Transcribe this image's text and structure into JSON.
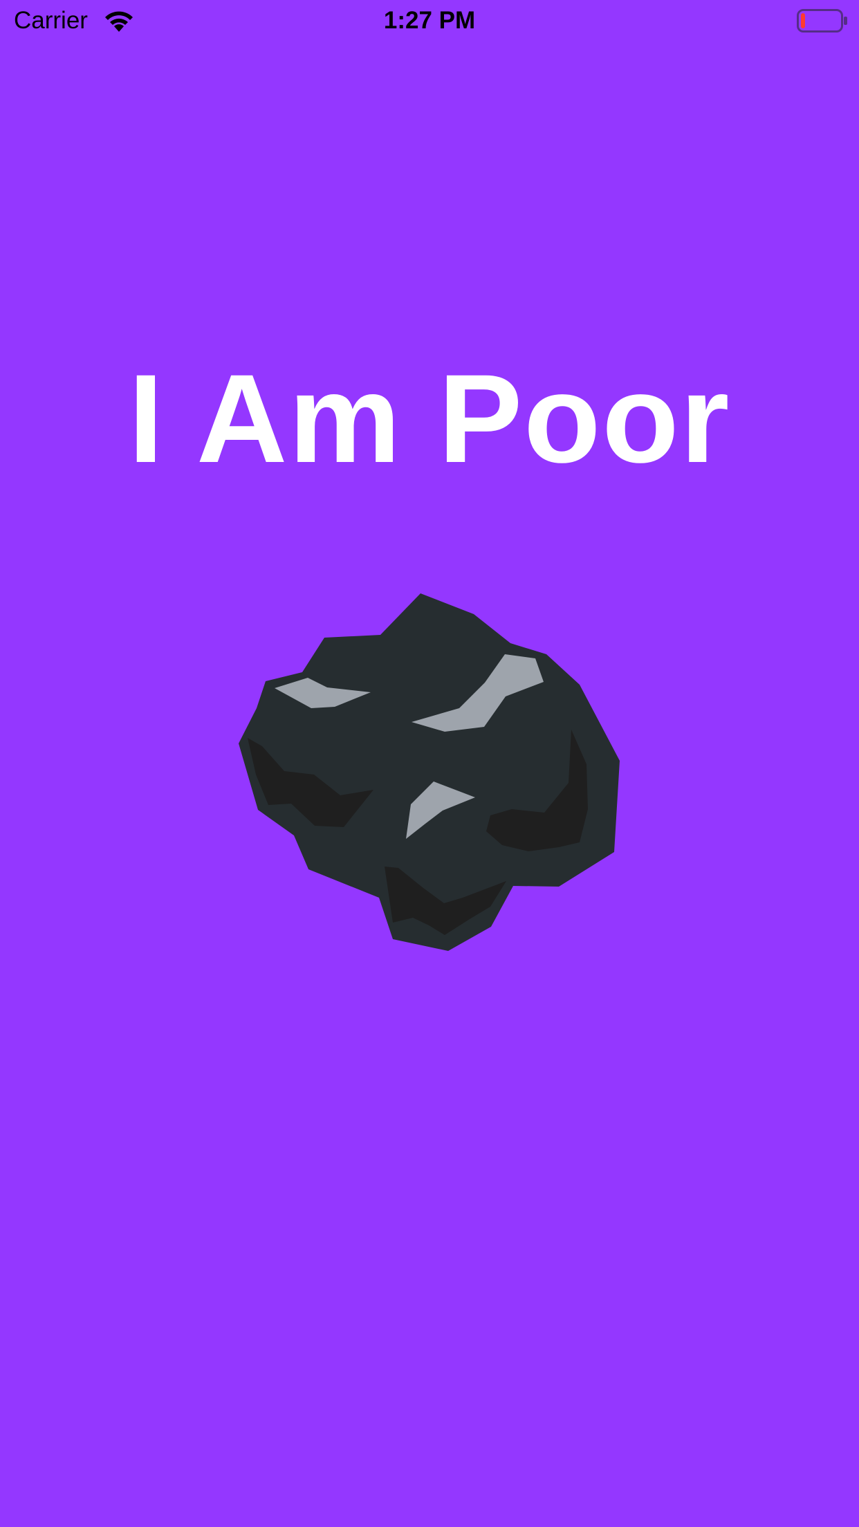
{
  "colors": {
    "background": "#9437FF",
    "title": "#FFFFFF",
    "status_text": "#000000",
    "battery_low": "#FF3B30",
    "coal_dark": "#262D30",
    "coal_shadow": "#1F1F1F",
    "coal_highlight": "#9EA4AC"
  },
  "status_bar": {
    "carrier": "Carrier",
    "time": "1:27 PM",
    "wifi_icon": "wifi-icon",
    "battery_icon": "battery-low-icon",
    "battery_level": 0.1
  },
  "main": {
    "title": "I Am Poor",
    "image_icon": "coal-icon"
  }
}
